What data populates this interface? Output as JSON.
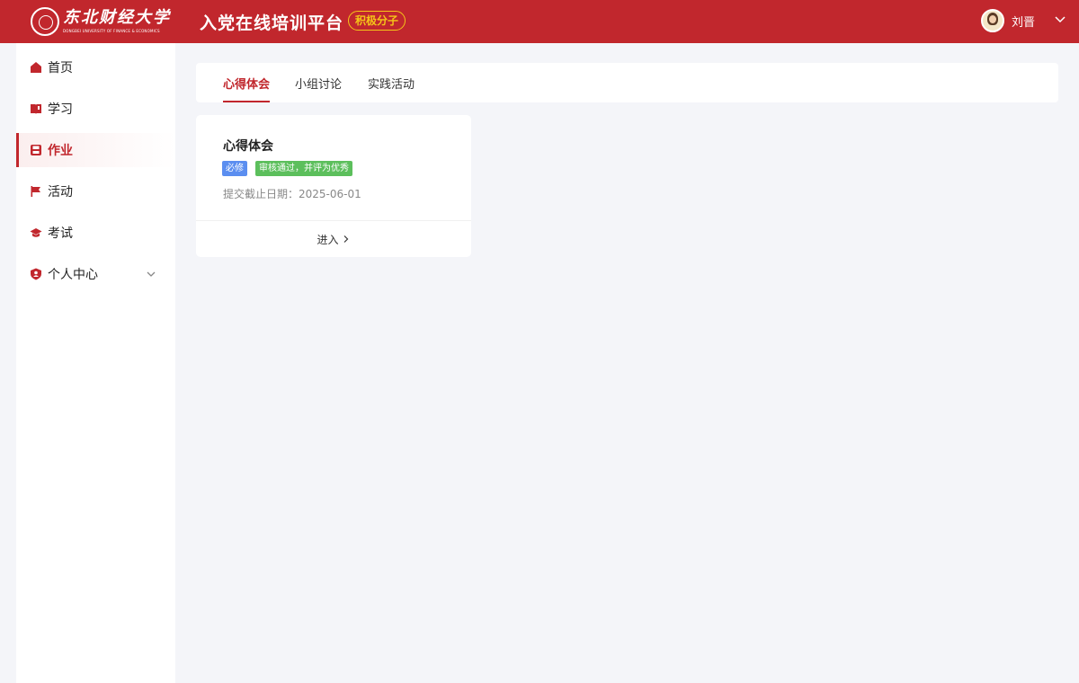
{
  "header": {
    "logo_cn": "东北财经大学",
    "logo_en": "DONGBEI UNIVERSITY OF FINANCE & ECONOMICS",
    "platform_title": "入党在线培训平台",
    "role_badge": "积极分子",
    "user_name": "刘晋",
    "brand_color": "#c1272d",
    "badge_color": "#f5c518"
  },
  "sidebar": {
    "items": [
      {
        "label": "首页",
        "icon": "home-icon"
      },
      {
        "label": "学习",
        "icon": "book-icon"
      },
      {
        "label": "作业",
        "icon": "save-icon",
        "active": true
      },
      {
        "label": "活动",
        "icon": "flag-icon"
      },
      {
        "label": "考试",
        "icon": "graduation-cap-icon"
      },
      {
        "label": "个人中心",
        "icon": "user-shield-icon",
        "expandable": true
      }
    ]
  },
  "tabs": [
    {
      "label": "心得体会",
      "active": true
    },
    {
      "label": "小组讨论"
    },
    {
      "label": "实践活动"
    }
  ],
  "card": {
    "title": "心得体会",
    "tag_required": "必修",
    "tag_status": "审核通过，并评为优秀",
    "deadline": "提交截止日期：2025-06-01",
    "enter_label": "进入"
  }
}
